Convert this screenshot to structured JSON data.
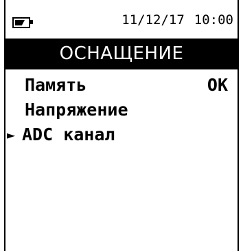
{
  "status": {
    "battery_icon": "battery-low-icon",
    "date": "11/12/17",
    "time": "10:00"
  },
  "title": "ОСНАЩЕНИЕ",
  "menu": {
    "selected_marker": "►",
    "items": [
      {
        "label": "Память",
        "value": "OK",
        "selected": false
      },
      {
        "label": "Напряжение",
        "value": "",
        "selected": false
      },
      {
        "label": "ADC канал",
        "value": "",
        "selected": true
      }
    ]
  },
  "colors": {
    "background": "#ffffff",
    "foreground": "#000000",
    "title_bar_bg": "#000000",
    "title_bar_fg": "#ffffff"
  }
}
